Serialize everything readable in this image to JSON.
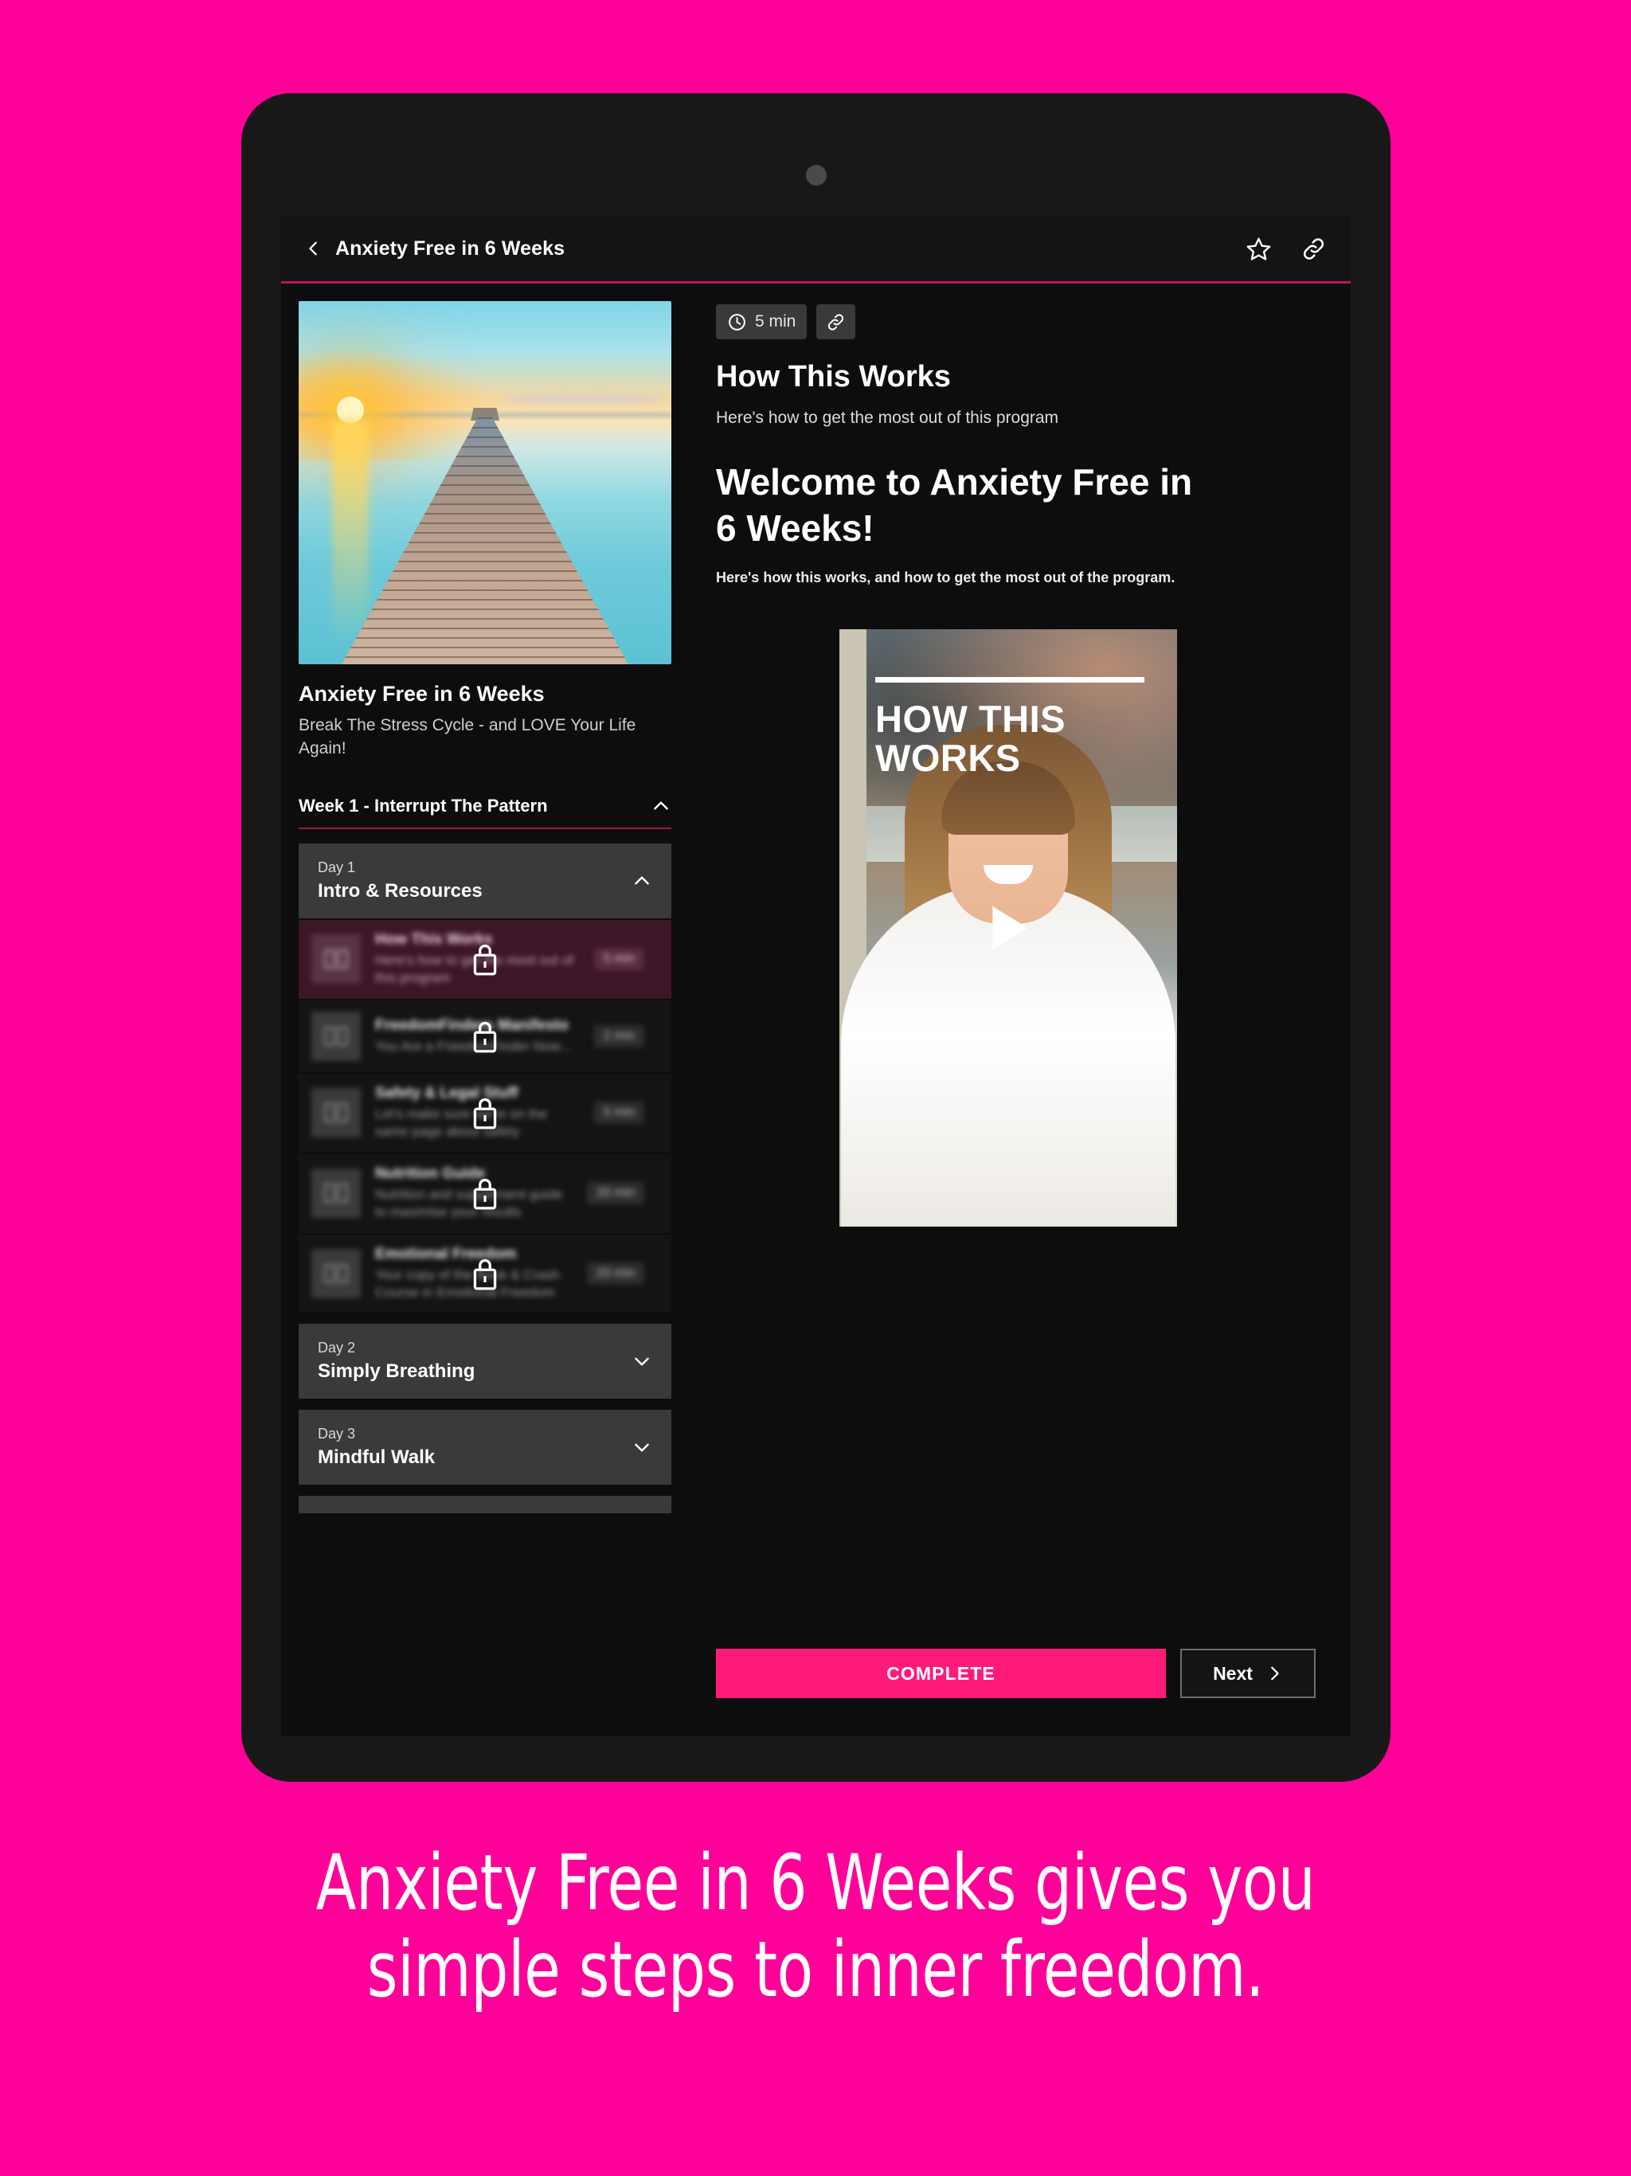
{
  "theme": {
    "page_background": "#ff0099",
    "accent_pink": "#ff1a7a",
    "divider_pink": "#b5175e",
    "screen_background": "#0d0d0d"
  },
  "header": {
    "back_icon": "chevron-left-icon",
    "title": "Anxiety Free in 6 Weeks",
    "star_icon": "star-outline-icon",
    "link_icon": "link-icon"
  },
  "sidebar": {
    "hero_image_alt": "sunset-pier-over-calm-water",
    "course_title": "Anxiety Free in 6 Weeks",
    "course_subtitle": "Break The Stress Cycle - and LOVE Your Life Again!",
    "week": {
      "label": "Week 1 - Interrupt The Pattern",
      "toggle_icon": "chevron-up-icon",
      "expanded": true
    },
    "days": [
      {
        "kicker": "Day 1",
        "name": "Intro & Resources",
        "toggle_icon": "chevron-up-icon",
        "expanded": true,
        "lessons": [
          {
            "title": "How This Works",
            "description": "Here's how to get the most out of this program",
            "duration": "5 min",
            "icon": "book-icon",
            "locked": true,
            "active": true
          },
          {
            "title": "FreedomFinders Manifesto",
            "description": "You Are a FreedomFinder Now...",
            "duration": "2 min",
            "icon": "book-icon",
            "locked": true,
            "active": false
          },
          {
            "title": "Safety & Legal Stuff",
            "description": "Let's make sure we're on the same page about safety",
            "duration": "5 min",
            "icon": "book-icon",
            "locked": true,
            "active": false
          },
          {
            "title": "Nutrition Guide",
            "description": "Nutrition and supplement guide to maximise your results",
            "duration": "20 min",
            "icon": "book-icon",
            "locked": true,
            "active": false
          },
          {
            "title": "Emotional Freedom",
            "description": "Your copy of the Book & Crash Course in Emotional Freedom",
            "duration": "20 min",
            "icon": "book-icon",
            "locked": true,
            "active": false
          }
        ]
      },
      {
        "kicker": "Day 2",
        "name": "Simply Breathing",
        "toggle_icon": "chevron-down-icon",
        "expanded": false,
        "lessons": []
      },
      {
        "kicker": "Day 3",
        "name": "Mindful Walk",
        "toggle_icon": "chevron-down-icon",
        "expanded": false,
        "lessons": []
      }
    ]
  },
  "main": {
    "duration_badge": {
      "icon": "clock-icon",
      "label": "5 min"
    },
    "link_badge": {
      "icon": "link-icon"
    },
    "lesson_heading": "How This Works",
    "lesson_subheading": "Here's how to get the most out of this program",
    "welcome_heading": "Welcome to Anxiety Free in 6 Weeks!",
    "welcome_subtext": "Here's how this works, and how to get the most out of the program.",
    "video": {
      "overlay_title": "HOW THIS WORKS",
      "play_icon": "play-triangle-icon"
    },
    "actions": {
      "complete_label": "COMPLETE",
      "next_label": "Next",
      "next_icon": "chevron-right-icon"
    }
  },
  "caption": {
    "line1": "Anxiety Free in 6 Weeks gives you",
    "line2": "simple steps to inner freedom."
  }
}
